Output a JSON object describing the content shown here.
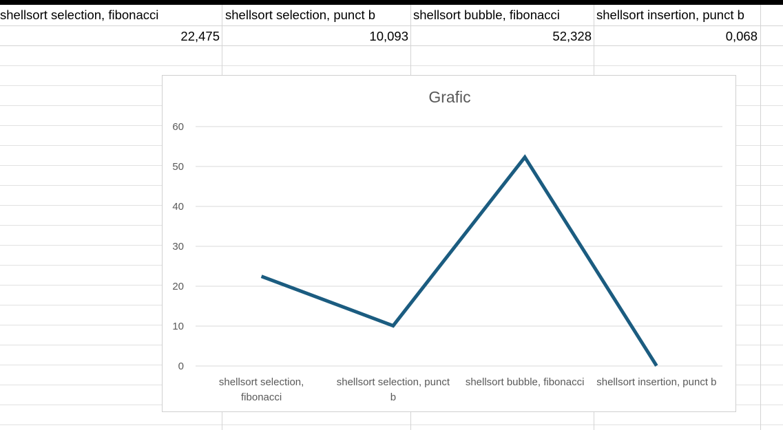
{
  "sheet": {
    "headers": [
      "shellsort selection, fibonacci",
      "shellsort selection, punct b",
      "shellsort bubble, fibonacci",
      "shellsort insertion, punct b"
    ],
    "values": [
      "22,475",
      "10,093",
      "52,328",
      "0,068"
    ]
  },
  "chart": {
    "title": "Grafic",
    "line_color": "#1b5c80"
  },
  "chart_data": {
    "type": "line",
    "title": "Grafic",
    "categories": [
      "shellsort selection, fibonacci",
      "shellsort selection, punct b",
      "shellsort bubble, fibonacci",
      "shellsort insertion, punct b"
    ],
    "category_tick_labels": [
      [
        "shellsort selection,",
        "fibonacci"
      ],
      [
        "shellsort selection, punct",
        "b"
      ],
      [
        "shellsort bubble, fibonacci"
      ],
      [
        "shellsort insertion, punct b"
      ]
    ],
    "series": [
      {
        "values": [
          22.475,
          10.093,
          52.328,
          0.068
        ]
      }
    ],
    "ylim": [
      0,
      60
    ],
    "yticks": [
      "0",
      "10",
      "20",
      "30",
      "40",
      "50",
      "60"
    ],
    "grid": true
  }
}
